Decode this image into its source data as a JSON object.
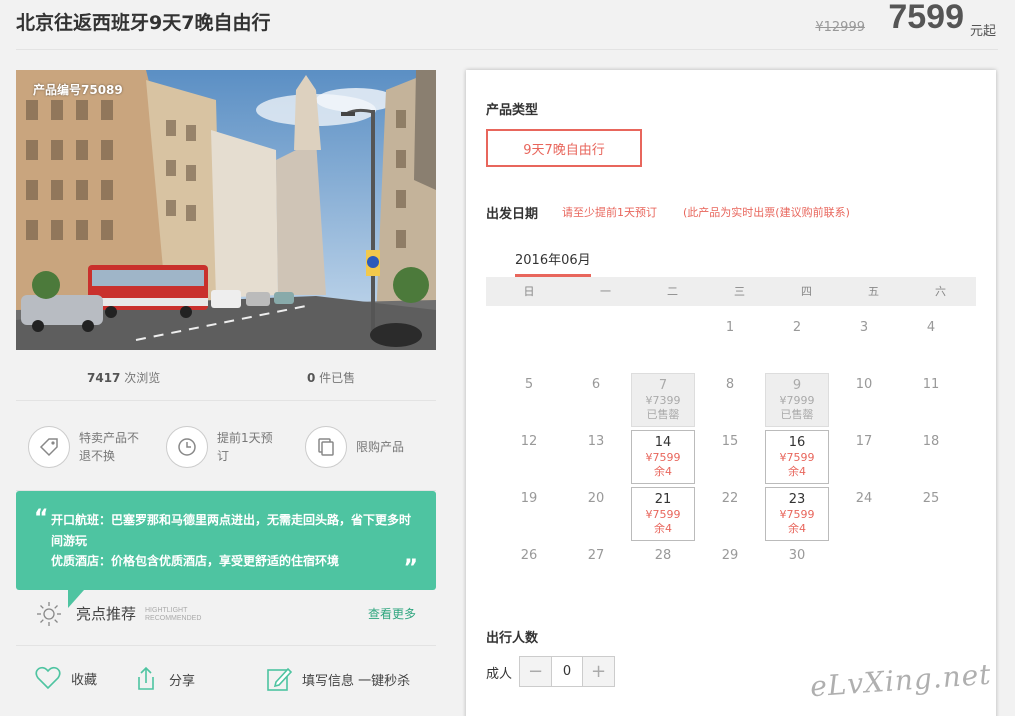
{
  "header": {
    "title": "北京往返西班牙9天7晚自由行",
    "original_price": "¥12999",
    "price": "7599",
    "price_unit": "元起"
  },
  "photo": {
    "product_no": "产品编号75089"
  },
  "stats": {
    "views_count": "7417",
    "views_label": " 次浏览",
    "sold_count": "0",
    "sold_label": " 件已售"
  },
  "features": [
    {
      "icon": "tag-icon",
      "label": "特卖产品不退不换"
    },
    {
      "icon": "clock-icon",
      "label": "提前1天预订"
    },
    {
      "icon": "copy-icon",
      "label": "限购产品"
    }
  ],
  "promo": {
    "line1": "开口航班：巴塞罗那和马德里两点进出，无需走回头路，省下更多时间游玩",
    "line2": "优质酒店：价格包含优质酒店，享受更舒适的住宿环境"
  },
  "highlight": {
    "title": "亮点推荐",
    "en_line1": "HIGHTLIGHT",
    "en_line2": "RECOMMENDED",
    "more": "查看更多"
  },
  "actions": {
    "favorite": "收藏",
    "share": "分享",
    "fill_info": "填写信息 一键秒杀"
  },
  "panel": {
    "type_title": "产品类型",
    "type_option": "9天7晚自由行",
    "date_title": "出发日期",
    "date_note1": "请至少提前1天预订",
    "date_note2": "(此产品为实时出票(建议购前联系)",
    "month": "2016年06月",
    "weekdays": [
      "日",
      "一",
      "二",
      "三",
      "四",
      "五",
      "六"
    ],
    "pax_title": "出行人数",
    "adult_label": "成人",
    "adult_count": "0",
    "minus": "−",
    "plus": "+"
  },
  "calendar": {
    "days": [
      {
        "d": "1",
        "col": 3,
        "row": 0
      },
      {
        "d": "2",
        "col": 4,
        "row": 0
      },
      {
        "d": "3",
        "col": 5,
        "row": 0
      },
      {
        "d": "4",
        "col": 6,
        "row": 0
      },
      {
        "d": "5",
        "col": 0,
        "row": 1
      },
      {
        "d": "6",
        "col": 1,
        "row": 1
      },
      {
        "d": "7",
        "col": 2,
        "row": 1,
        "state": "soldout",
        "price": "¥7399",
        "status": "已售罄"
      },
      {
        "d": "8",
        "col": 3,
        "row": 1
      },
      {
        "d": "9",
        "col": 4,
        "row": 1,
        "state": "soldout",
        "price": "¥7999",
        "status": "已售罄"
      },
      {
        "d": "10",
        "col": 5,
        "row": 1
      },
      {
        "d": "11",
        "col": 6,
        "row": 1
      },
      {
        "d": "12",
        "col": 0,
        "row": 2
      },
      {
        "d": "13",
        "col": 1,
        "row": 2
      },
      {
        "d": "14",
        "col": 2,
        "row": 2,
        "state": "avail",
        "price": "¥7599",
        "status": "余4"
      },
      {
        "d": "15",
        "col": 3,
        "row": 2
      },
      {
        "d": "16",
        "col": 4,
        "row": 2,
        "state": "avail",
        "price": "¥7599",
        "status": "余4"
      },
      {
        "d": "17",
        "col": 5,
        "row": 2
      },
      {
        "d": "18",
        "col": 6,
        "row": 2
      },
      {
        "d": "19",
        "col": 0,
        "row": 3
      },
      {
        "d": "20",
        "col": 1,
        "row": 3
      },
      {
        "d": "21",
        "col": 2,
        "row": 3,
        "state": "avail",
        "price": "¥7599",
        "status": "余4"
      },
      {
        "d": "22",
        "col": 3,
        "row": 3
      },
      {
        "d": "23",
        "col": 4,
        "row": 3,
        "state": "avail",
        "price": "¥7599",
        "status": "余4"
      },
      {
        "d": "24",
        "col": 5,
        "row": 3
      },
      {
        "d": "25",
        "col": 6,
        "row": 3
      },
      {
        "d": "26",
        "col": 0,
        "row": 4
      },
      {
        "d": "27",
        "col": 1,
        "row": 4
      },
      {
        "d": "28",
        "col": 2,
        "row": 4
      },
      {
        "d": "29",
        "col": 3,
        "row": 4
      },
      {
        "d": "30",
        "col": 4,
        "row": 4
      }
    ]
  },
  "watermark": "eLvXing.net",
  "colors": {
    "accent": "#e8665c",
    "promo_green": "#4ec4a1",
    "more_link": "#2fa67f"
  }
}
